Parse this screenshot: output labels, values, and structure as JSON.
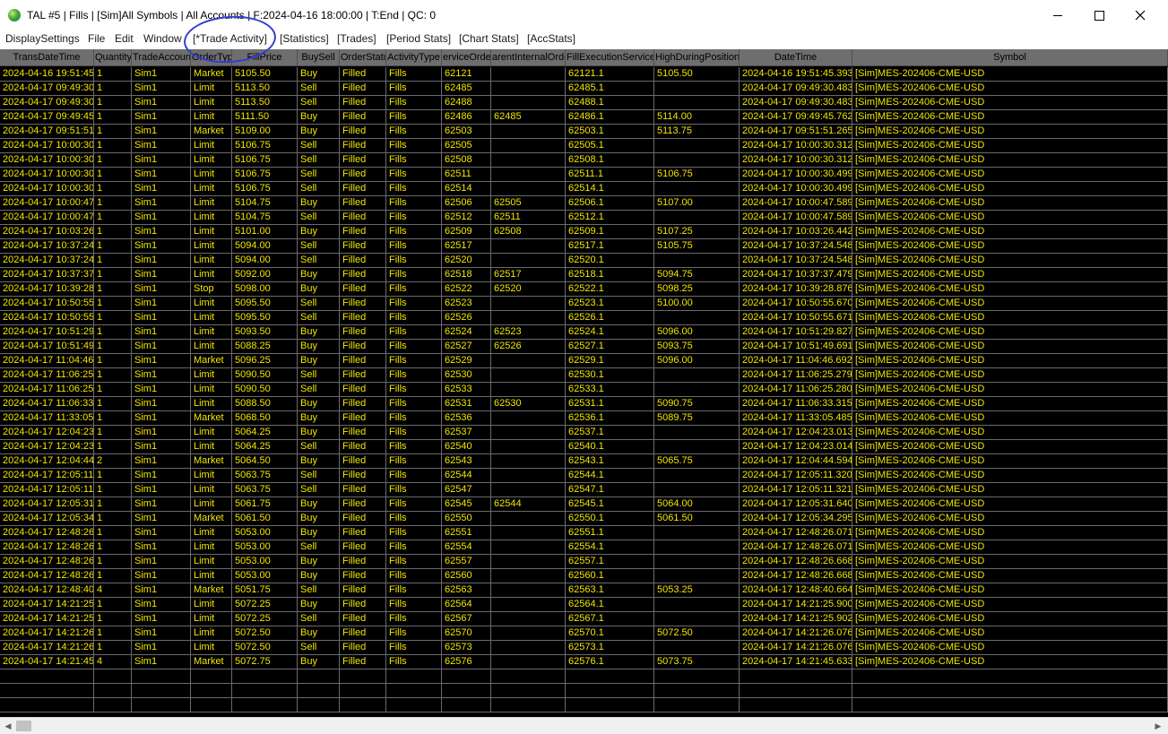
{
  "window": {
    "title": "TAL #5 | Fills | [Sim]All Symbols | All Accounts | F:2024-04-16  18:00:00 | T:End | QC: 0"
  },
  "menu": [
    "DisplaySettings",
    "File",
    "Edit",
    "Window",
    "[*Trade Activity]",
    "[Statistics]",
    "[Trades]",
    "[Period Stats]",
    "[Chart Stats]",
    "[AccStats]"
  ],
  "columns": [
    "TransDateTime",
    "Quantity",
    "TradeAccount",
    "OrderType",
    "FillPrice",
    "BuySell",
    "OrderStatus",
    "ActivityType",
    "erviceOrder",
    "arentInternalOrder",
    "FillExecutionServiceID",
    "HighDuringPosition",
    "DateTime",
    "Symbol"
  ],
  "rows": [
    [
      "2024-04-16  19:51:45.",
      "1",
      "Sim1",
      "Market",
      "5105.50",
      "Buy",
      "Filled",
      "Fills",
      "62121",
      "",
      "62121.1",
      "5105.50",
      "2024-04-16  19:51:45.3931",
      "[Sim]MES-202406-CME-USD"
    ],
    [
      "2024-04-17  09:49:30.",
      "1",
      "Sim1",
      "Limit",
      "5113.50",
      "Sell",
      "Filled",
      "Fills",
      "62485",
      "",
      "62485.1",
      "",
      "2024-04-17  09:49:30.4834",
      "[Sim]MES-202406-CME-USD"
    ],
    [
      "2024-04-17  09:49:30.",
      "1",
      "Sim1",
      "Limit",
      "5113.50",
      "Sell",
      "Filled",
      "Fills",
      "62488",
      "",
      "62488.1",
      "",
      "2024-04-17  09:49:30.4838",
      "[Sim]MES-202406-CME-USD"
    ],
    [
      "2024-04-17  09:49:45.",
      "1",
      "Sim1",
      "Limit",
      "5111.50",
      "Buy",
      "Filled",
      "Fills",
      "62486",
      "62485",
      "62486.1",
      "5114.00",
      "2024-04-17  09:49:45.7627",
      "[Sim]MES-202406-CME-USD"
    ],
    [
      "2024-04-17  09:51:51.",
      "1",
      "Sim1",
      "Market",
      "5109.00",
      "Buy",
      "Filled",
      "Fills",
      "62503",
      "",
      "62503.1",
      "5113.75",
      "2024-04-17  09:51:51.2659",
      "[Sim]MES-202406-CME-USD"
    ],
    [
      "2024-04-17  10:00:30.",
      "1",
      "Sim1",
      "Limit",
      "5106.75",
      "Sell",
      "Filled",
      "Fills",
      "62505",
      "",
      "62505.1",
      "",
      "2024-04-17  10:00:30.3124",
      "[Sim]MES-202406-CME-USD"
    ],
    [
      "2024-04-17  10:00:30.",
      "1",
      "Sim1",
      "Limit",
      "5106.75",
      "Sell",
      "Filled",
      "Fills",
      "62508",
      "",
      "62508.1",
      "",
      "2024-04-17  10:00:30.3126",
      "[Sim]MES-202406-CME-USD"
    ],
    [
      "2024-04-17  10:00:30.",
      "1",
      "Sim1",
      "Limit",
      "5106.75",
      "Sell",
      "Filled",
      "Fills",
      "62511",
      "",
      "62511.1",
      "5106.75",
      "2024-04-17  10:00:30.4996",
      "[Sim]MES-202406-CME-USD"
    ],
    [
      "2024-04-17  10:00:30.",
      "1",
      "Sim1",
      "Limit",
      "5106.75",
      "Sell",
      "Filled",
      "Fills",
      "62514",
      "",
      "62514.1",
      "",
      "2024-04-17  10:00:30.4997",
      "[Sim]MES-202406-CME-USD"
    ],
    [
      "2024-04-17  10:00:47.",
      "1",
      "Sim1",
      "Limit",
      "5104.75",
      "Buy",
      "Filled",
      "Fills",
      "62506",
      "62505",
      "62506.1",
      "5107.00",
      "2024-04-17  10:00:47.5894",
      "[Sim]MES-202406-CME-USD"
    ],
    [
      "2024-04-17  10:00:47.",
      "1",
      "Sim1",
      "Limit",
      "5104.75",
      "Sell",
      "Filled",
      "Fills",
      "62512",
      "62511",
      "62512.1",
      "",
      "2024-04-17  10:00:47.5895",
      "[Sim]MES-202406-CME-USD"
    ],
    [
      "2024-04-17  10:03:26.",
      "1",
      "Sim1",
      "Limit",
      "5101.00",
      "Buy",
      "Filled",
      "Fills",
      "62509",
      "62508",
      "62509.1",
      "5107.25",
      "2024-04-17  10:03:26.4422",
      "[Sim]MES-202406-CME-USD"
    ],
    [
      "2024-04-17  10:37:24.",
      "1",
      "Sim1",
      "Limit",
      "5094.00",
      "Sell",
      "Filled",
      "Fills",
      "62517",
      "",
      "62517.1",
      "5105.75",
      "2024-04-17  10:37:24.5484",
      "[Sim]MES-202406-CME-USD"
    ],
    [
      "2024-04-17  10:37:24.",
      "1",
      "Sim1",
      "Limit",
      "5094.00",
      "Sell",
      "Filled",
      "Fills",
      "62520",
      "",
      "62520.1",
      "",
      "2024-04-17  10:37:24.5489",
      "[Sim]MES-202406-CME-USD"
    ],
    [
      "2024-04-17  10:37:37.",
      "1",
      "Sim1",
      "Limit",
      "5092.00",
      "Buy",
      "Filled",
      "Fills",
      "62518",
      "62517",
      "62518.1",
      "5094.75",
      "2024-04-17  10:37:37.4795",
      "[Sim]MES-202406-CME-USD"
    ],
    [
      "2024-04-17  10:39:28.",
      "1",
      "Sim1",
      "Stop",
      "5098.00",
      "Buy",
      "Filled",
      "Fills",
      "62522",
      "62520",
      "62522.1",
      "5098.25",
      "2024-04-17  10:39:28.8761",
      "[Sim]MES-202406-CME-USD"
    ],
    [
      "2024-04-17  10:50:55.",
      "1",
      "Sim1",
      "Limit",
      "5095.50",
      "Sell",
      "Filled",
      "Fills",
      "62523",
      "",
      "62523.1",
      "5100.00",
      "2024-04-17  10:50:55.6708",
      "[Sim]MES-202406-CME-USD"
    ],
    [
      "2024-04-17  10:50:55.",
      "1",
      "Sim1",
      "Limit",
      "5095.50",
      "Sell",
      "Filled",
      "Fills",
      "62526",
      "",
      "62526.1",
      "",
      "2024-04-17  10:50:55.6710",
      "[Sim]MES-202406-CME-USD"
    ],
    [
      "2024-04-17  10:51:29.",
      "1",
      "Sim1",
      "Limit",
      "5093.50",
      "Buy",
      "Filled",
      "Fills",
      "62524",
      "62523",
      "62524.1",
      "5096.00",
      "2024-04-17  10:51:29.8272",
      "[Sim]MES-202406-CME-USD"
    ],
    [
      "2024-04-17  10:51:49.",
      "1",
      "Sim1",
      "Limit",
      "5088.25",
      "Buy",
      "Filled",
      "Fills",
      "62527",
      "62526",
      "62527.1",
      "5093.75",
      "2024-04-17  10:51:49.6910",
      "[Sim]MES-202406-CME-USD"
    ],
    [
      "2024-04-17  11:04:46.",
      "1",
      "Sim1",
      "Market",
      "5096.25",
      "Buy",
      "Filled",
      "Fills",
      "62529",
      "",
      "62529.1",
      "5096.00",
      "2024-04-17  11:04:46.6923",
      "[Sim]MES-202406-CME-USD"
    ],
    [
      "2024-04-17  11:06:25.",
      "1",
      "Sim1",
      "Limit",
      "5090.50",
      "Sell",
      "Filled",
      "Fills",
      "62530",
      "",
      "62530.1",
      "",
      "2024-04-17  11:06:25.2799",
      "[Sim]MES-202406-CME-USD"
    ],
    [
      "2024-04-17  11:06:25.",
      "1",
      "Sim1",
      "Limit",
      "5090.50",
      "Sell",
      "Filled",
      "Fills",
      "62533",
      "",
      "62533.1",
      "",
      "2024-04-17  11:06:25.2801",
      "[Sim]MES-202406-CME-USD"
    ],
    [
      "2024-04-17  11:06:33.",
      "1",
      "Sim1",
      "Limit",
      "5088.50",
      "Buy",
      "Filled",
      "Fills",
      "62531",
      "62530",
      "62531.1",
      "5090.75",
      "2024-04-17  11:06:33.3155",
      "[Sim]MES-202406-CME-USD"
    ],
    [
      "2024-04-17  11:33:05.",
      "1",
      "Sim1",
      "Market",
      "5068.50",
      "Buy",
      "Filled",
      "Fills",
      "62536",
      "",
      "62536.1",
      "5089.75",
      "2024-04-17  11:33:05.4852",
      "[Sim]MES-202406-CME-USD"
    ],
    [
      "2024-04-17  12:04:23.",
      "1",
      "Sim1",
      "Limit",
      "5064.25",
      "Buy",
      "Filled",
      "Fills",
      "62537",
      "",
      "62537.1",
      "",
      "2024-04-17  12:04:23.0133",
      "[Sim]MES-202406-CME-USD"
    ],
    [
      "2024-04-17  12:04:23.",
      "1",
      "Sim1",
      "Limit",
      "5064.25",
      "Sell",
      "Filled",
      "Fills",
      "62540",
      "",
      "62540.1",
      "",
      "2024-04-17  12:04:23.0148",
      "[Sim]MES-202406-CME-USD"
    ],
    [
      "2024-04-17  12:04:44.",
      "2",
      "Sim1",
      "Market",
      "5064.50",
      "Buy",
      "Filled",
      "Fills",
      "62543",
      "",
      "62543.1",
      "5065.75",
      "2024-04-17  12:04:44.5949",
      "[Sim]MES-202406-CME-USD"
    ],
    [
      "2024-04-17  12:05:11.",
      "1",
      "Sim1",
      "Limit",
      "5063.75",
      "Sell",
      "Filled",
      "Fills",
      "62544",
      "",
      "62544.1",
      "",
      "2024-04-17  12:05:11.3208",
      "[Sim]MES-202406-CME-USD"
    ],
    [
      "2024-04-17  12:05:11.",
      "1",
      "Sim1",
      "Limit",
      "5063.75",
      "Sell",
      "Filled",
      "Fills",
      "62547",
      "",
      "62547.1",
      "",
      "2024-04-17  12:05:11.3217",
      "[Sim]MES-202406-CME-USD"
    ],
    [
      "2024-04-17  12:05:31.",
      "1",
      "Sim1",
      "Limit",
      "5061.75",
      "Buy",
      "Filled",
      "Fills",
      "62545",
      "62544",
      "62545.1",
      "5064.00",
      "2024-04-17  12:05:31.6402",
      "[Sim]MES-202406-CME-USD"
    ],
    [
      "2024-04-17  12:05:34.",
      "1",
      "Sim1",
      "Market",
      "5061.50",
      "Buy",
      "Filled",
      "Fills",
      "62550",
      "",
      "62550.1",
      "5061.50",
      "2024-04-17  12:05:34.2954",
      "[Sim]MES-202406-CME-USD"
    ],
    [
      "2024-04-17  12:48:26.",
      "1",
      "Sim1",
      "Limit",
      "5053.00",
      "Buy",
      "Filled",
      "Fills",
      "62551",
      "",
      "62551.1",
      "",
      "2024-04-17  12:48:26.0714",
      "[Sim]MES-202406-CME-USD"
    ],
    [
      "2024-04-17  12:48:26.",
      "1",
      "Sim1",
      "Limit",
      "5053.00",
      "Sell",
      "Filled",
      "Fills",
      "62554",
      "",
      "62554.1",
      "",
      "2024-04-17  12:48:26.0718",
      "[Sim]MES-202406-CME-USD"
    ],
    [
      "2024-04-17  12:48:26.",
      "1",
      "Sim1",
      "Limit",
      "5053.00",
      "Buy",
      "Filled",
      "Fills",
      "62557",
      "",
      "62557.1",
      "",
      "2024-04-17  12:48:26.6686",
      "[Sim]MES-202406-CME-USD"
    ],
    [
      "2024-04-17  12:48:26.",
      "1",
      "Sim1",
      "Limit",
      "5053.00",
      "Buy",
      "Filled",
      "Fills",
      "62560",
      "",
      "62560.1",
      "",
      "2024-04-17  12:48:26.6688",
      "[Sim]MES-202406-CME-USD"
    ],
    [
      "2024-04-17  12:48:40.",
      "4",
      "Sim1",
      "Market",
      "5051.75",
      "Sell",
      "Filled",
      "Fills",
      "62563",
      "",
      "62563.1",
      "5053.25",
      "2024-04-17  12:48:40.6645",
      "[Sim]MES-202406-CME-USD"
    ],
    [
      "2024-04-17  14:21:25.",
      "1",
      "Sim1",
      "Limit",
      "5072.25",
      "Buy",
      "Filled",
      "Fills",
      "62564",
      "",
      "62564.1",
      "",
      "2024-04-17  14:21:25.9002",
      "[Sim]MES-202406-CME-USD"
    ],
    [
      "2024-04-17  14:21:25.",
      "1",
      "Sim1",
      "Limit",
      "5072.25",
      "Sell",
      "Filled",
      "Fills",
      "62567",
      "",
      "62567.1",
      "",
      "2024-04-17  14:21:25.9023",
      "[Sim]MES-202406-CME-USD"
    ],
    [
      "2024-04-17  14:21:26.",
      "1",
      "Sim1",
      "Limit",
      "5072.50",
      "Buy",
      "Filled",
      "Fills",
      "62570",
      "",
      "62570.1",
      "5072.50",
      "2024-04-17  14:21:26.0762",
      "[Sim]MES-202406-CME-USD"
    ],
    [
      "2024-04-17  14:21:26.",
      "1",
      "Sim1",
      "Limit",
      "5072.50",
      "Sell",
      "Filled",
      "Fills",
      "62573",
      "",
      "62573.1",
      "",
      "2024-04-17  14:21:26.0764",
      "[Sim]MES-202406-CME-USD"
    ],
    [
      "2024-04-17  14:21:45.",
      "4",
      "Sim1",
      "Market",
      "5072.75",
      "Buy",
      "Filled",
      "Fills",
      "62576",
      "",
      "62576.1",
      "5073.75",
      "2024-04-17  14:21:45.6331",
      "[Sim]MES-202406-CME-USD"
    ]
  ],
  "colors": {
    "grid_background": "#000000",
    "cell_text": "#f2e600",
    "header_background": "#6e6e6e",
    "annotation_circle": "#2f3fd0"
  }
}
